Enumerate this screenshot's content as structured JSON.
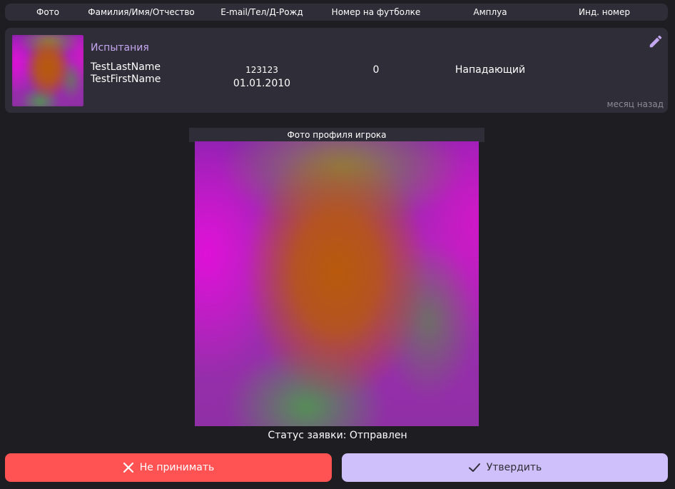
{
  "table_header": {
    "photo": "Фото",
    "full_name": "Фамилия/Имя/Отчество",
    "contacts": "E-mail/Тел/Д-Рожд",
    "jersey_number": "Номер на футболке",
    "position": "Амплуа",
    "ind_number": "Инд. номер"
  },
  "player": {
    "team": "Испытания",
    "last_name": "TestLastName",
    "first_name": "TestFirstName",
    "phone": "123123",
    "birth_date": "01.01.2010",
    "jersey_number": "0",
    "position": "Нападающий",
    "updated": "месяц назад"
  },
  "profile_photo": {
    "caption": "Фото профиля игрока"
  },
  "status": {
    "text": "Статус заявки: Отправлен"
  },
  "actions": {
    "reject_label": "Не принимать",
    "approve_label": "Утвердить"
  },
  "colors": {
    "background": "#1e1d22",
    "panel": "#2f2d37",
    "accent": "#c3a6f0",
    "reject": "#ff5252",
    "approve": "#cfc0fb"
  },
  "icons": {
    "edit": "pencil-icon",
    "reject": "close-icon",
    "approve": "check-icon"
  }
}
